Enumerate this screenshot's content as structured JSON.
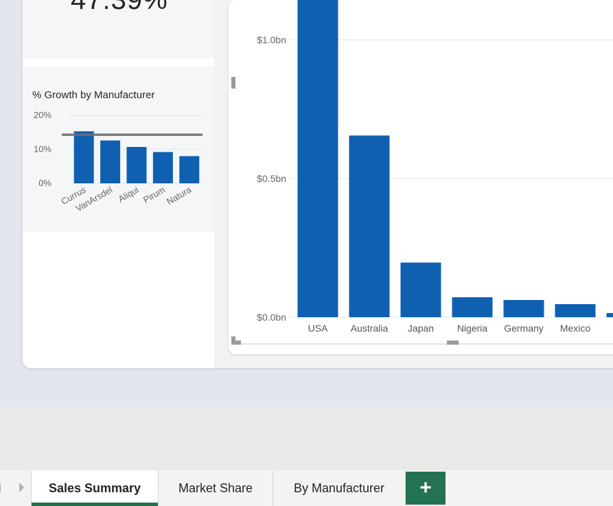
{
  "kpi": {
    "value": "47.39%"
  },
  "growth_chart": {
    "title": "% Growth by Manufacturer",
    "chart_data": {
      "type": "bar",
      "categories": [
        "Currus",
        "VanArsdel",
        "Aliqui",
        "Pirum",
        "Natura"
      ],
      "values": [
        15.3,
        12.6,
        10.7,
        9.2,
        8.0
      ],
      "ytick_labels": [
        "0%",
        "10%",
        "20%"
      ],
      "ylim": [
        0,
        20
      ],
      "reference_line": 14.3,
      "bar_color": "#1060b2",
      "reference_line_color": "#707070"
    }
  },
  "country_chart": {
    "chart_data": {
      "type": "bar",
      "categories": [
        "USA",
        "Australia",
        "Japan",
        "Nigeria",
        "Germany",
        "Mexico",
        ""
      ],
      "values": [
        1.25,
        0.655,
        0.197,
        0.072,
        0.062,
        0.047,
        0.015
      ],
      "ytick_labels": [
        "$0.0bn",
        "$0.5bn",
        "$1.0bn"
      ],
      "yticks": [
        0,
        0.5,
        1.0
      ],
      "ylim": [
        0,
        1.1
      ],
      "bar_color": "#1060b2"
    }
  },
  "tabs": [
    {
      "label": "Sales Summary",
      "active": true
    },
    {
      "label": "Market Share",
      "active": false
    },
    {
      "label": "By Manufacturer",
      "active": false
    }
  ],
  "add_tab": {
    "label": "+"
  }
}
